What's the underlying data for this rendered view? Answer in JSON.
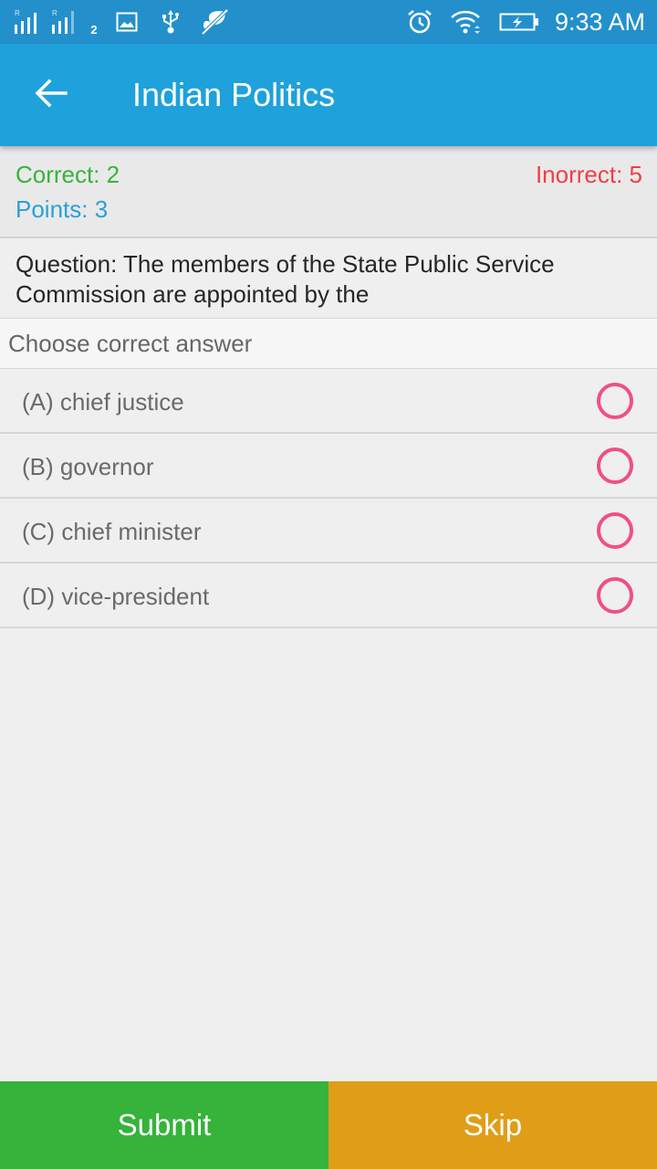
{
  "status_bar": {
    "time": "9:33 AM",
    "sim2_label": "2",
    "icons": [
      "signal-r-icon",
      "signal-r-icon",
      "image-icon",
      "usb-icon",
      "leaf-off-icon",
      "alarm-icon",
      "wifi-icon",
      "battery-charging-icon"
    ]
  },
  "app_bar": {
    "title": "Indian Politics",
    "back_icon": "arrow-left-icon"
  },
  "score": {
    "correct": "Correct: 2",
    "incorrect": "Inorrect: 5",
    "points": "Points: 3"
  },
  "question": {
    "text": "Question: The members of the State Public Service Commission are appointed by the"
  },
  "choose_label": "Choose correct answer",
  "options": [
    {
      "label": "(A) chief justice",
      "selected": false
    },
    {
      "label": "(B) governor",
      "selected": false
    },
    {
      "label": "(C) chief minister",
      "selected": false
    },
    {
      "label": "(D) vice-president",
      "selected": false
    }
  ],
  "buttons": {
    "submit": "Submit",
    "skip": "Skip"
  },
  "colors": {
    "app_bar": "#1fa1db",
    "status_bar": "#2390cc",
    "correct": "#37b43a",
    "incorrect": "#ef3e46",
    "points": "#2aa0d7",
    "radio": "#ef4f89",
    "submit": "#35b33a",
    "skip": "#e09d17"
  }
}
